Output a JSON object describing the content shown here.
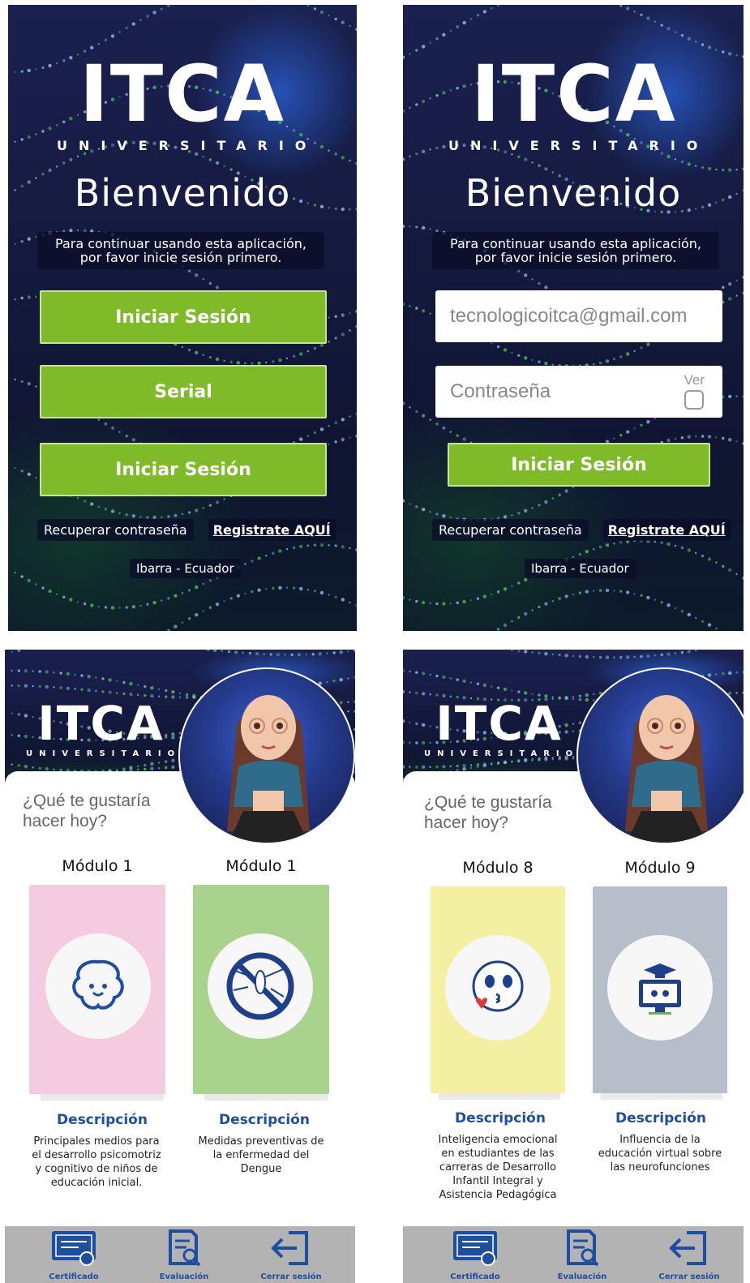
{
  "brand": {
    "logo_text": "ITCA",
    "logo_sub": "UNIVERSITARIO"
  },
  "login": {
    "title": "Bienvenido",
    "subtitle_line1": "Para continuar usando esta aplicación,",
    "subtitle_line2": "por favor inicie sesión primero.",
    "btn_login": "Iniciar Sesión",
    "btn_serial": "Serial",
    "btn_login2": "Iniciar Sesión",
    "recover_label": "Recuperar contraseña",
    "register_label": "Registrate AQUÍ",
    "location": "Ibarra - Ecuador"
  },
  "login_form": {
    "email_value": "tecnologicoitca@gmail.com",
    "password_placeholder": "Contraseña",
    "show_label": "Ver",
    "submit_label": "Iniciar Sesión"
  },
  "modules_left": {
    "question_line1": "¿Qué te gustaría",
    "question_line2": "hacer hoy?",
    "cards": [
      {
        "title": "Módulo 1",
        "color": "#f5cbe0",
        "icon": "brain-icon",
        "desc_title": "Descripción",
        "desc": "Principales medios para el desarrollo psicomotriz y cognitivo de niños de educación inicial."
      },
      {
        "title": "Módulo 1",
        "color": "#a9d38c",
        "icon": "no-mosquito-icon",
        "desc_title": "Descripción",
        "desc": "Medidas preventivas de la enfermedad del Dengue"
      }
    ]
  },
  "modules_right": {
    "question_line1": "¿Qué te gustaría",
    "question_line2": "hacer hoy?",
    "cards": [
      {
        "title": "Módulo 8",
        "color": "#f3f0a2",
        "icon": "kiss-emoji-icon",
        "desc_title": "Descripción",
        "desc": "Inteligencia emocional en estudiantes de las carreras de Desarrollo Infantil Integral y Asistencia Pedagógica"
      },
      {
        "title": "Módulo 9",
        "color": "#b6bfc9",
        "icon": "graduation-monitor-icon",
        "desc_title": "Descripción",
        "desc": "Influencia de la educación virtual sobre las neurofunciones"
      }
    ]
  },
  "nav": {
    "certificate": "Certificado",
    "evaluation": "Evaluación",
    "logout": "Cerrar sesión"
  },
  "colors": {
    "green": "#7fba28",
    "blue": "#1e4ea0",
    "navbar": "#b3b3b3"
  }
}
